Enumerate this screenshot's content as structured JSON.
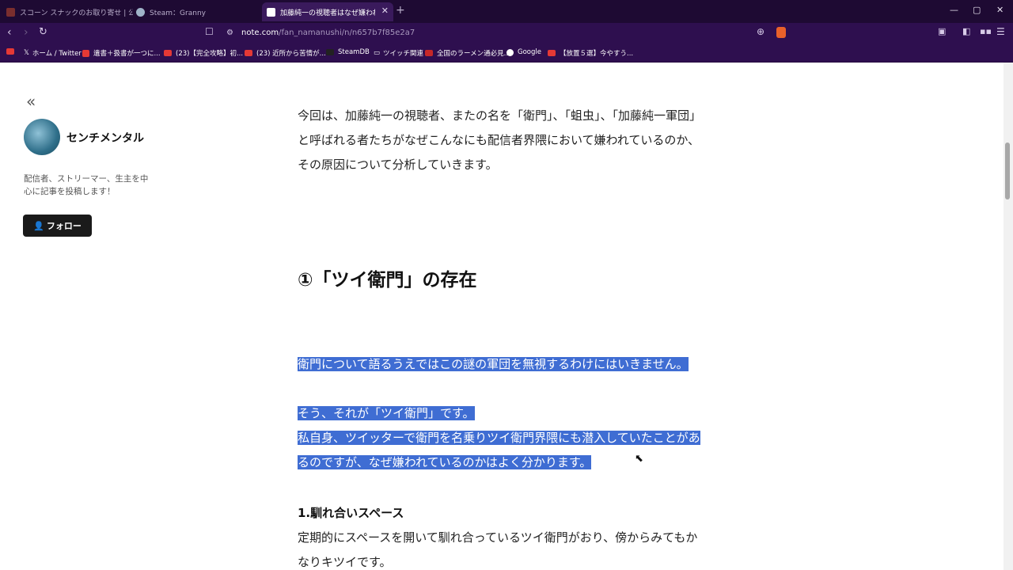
{
  "browser": {
    "tabs": [
      {
        "label": "スコーン スナックのお取り寄せ | 公式通販",
        "active": false
      },
      {
        "label": "Steam：Granny",
        "active": false
      },
      {
        "label": "加藤純一の視聴者はなぜ嫌われて",
        "active": true
      }
    ],
    "new_tab": "+",
    "window_controls": [
      "—",
      "▢",
      "✕"
    ],
    "url_domain": "note.com",
    "url_path": "/fan_namanushi/n/n657b7f85e2a7",
    "bookmarks": [
      "ホーム / Twitter",
      "遺書＋扱書が一つに...",
      "(23)【完全攻略】初...",
      "(23) 近所から苦情が...",
      "SteamDB",
      "ツイッチ関連",
      "全国のラーメン通必見...",
      "Google",
      "【放置５選】今やすう..."
    ]
  },
  "sidebar": {
    "collapse_label": "«",
    "author_name": "センチメンタル",
    "bio": "配信者、ストリーマー、生主を中心に記事を投稿します！",
    "follow_label": "フォロー"
  },
  "article": {
    "intro": "今回は、加藤純一の視聴者、またの名を「衛門」、「蛆虫」、「加藤純一軍団」と呼ばれる者たちがなぜこんなにも配信者界隈において嫌われているのか、その原因について分析していきます。",
    "heading": "①「ツイ衛門」の存在",
    "p1": "衛門について語るうえではこの謎の軍団を無視するわけにはいきません。",
    "p2": "そう、それが「ツイ衛門」です。",
    "p3": "私自身、ツイッターで衛門を名乗りツイ衛門界隈にも潜入していたことがあるのですが、なぜ嫌われているのかはよく分かります。",
    "subheading": "1.馴れ合いスペース",
    "p4": "定期的にスペースを開いて馴れ合っているツイ衛門がおり、傍からみてもかなりキツイです。"
  },
  "colors": {
    "chrome_dark": "#1e0a33",
    "chrome": "#2e0f4f",
    "selection": "#3f6dd3"
  }
}
